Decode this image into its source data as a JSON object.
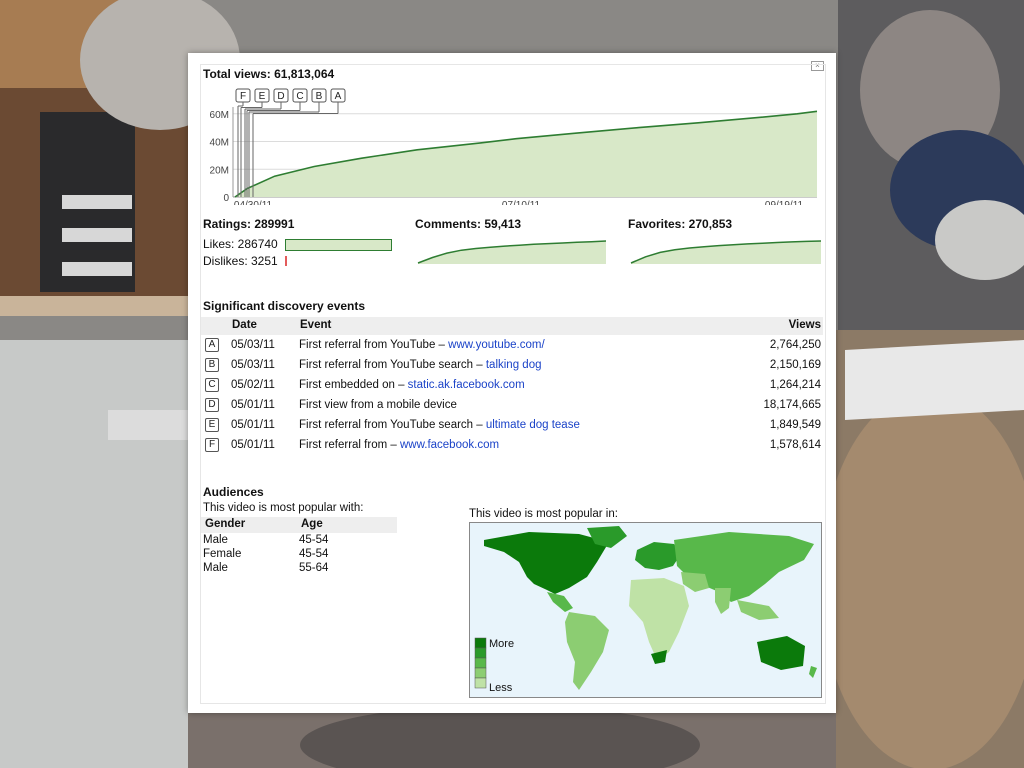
{
  "header": {
    "total_views_label": "Total views: 61,813,064"
  },
  "chart_data": [
    {
      "type": "area",
      "title": "Total views: 61,813,064",
      "x_ticks": [
        "04/30/11",
        "07/10/11",
        "09/19/11"
      ],
      "y_ticks": [
        "0",
        "20M",
        "40M",
        "60M"
      ],
      "ylim": [
        0,
        62000000
      ],
      "x": [
        "04/30/11",
        "05/03/11",
        "05/10/11",
        "05/20/11",
        "06/01/11",
        "06/15/11",
        "07/01/11",
        "07/10/11",
        "07/25/11",
        "08/10/11",
        "08/25/11",
        "09/10/11",
        "09/19/11",
        "09/24/11"
      ],
      "values": [
        0,
        6000000,
        15000000,
        22000000,
        28000000,
        34000000,
        39000000,
        42000000,
        46000000,
        50000000,
        53500000,
        57500000,
        60000000,
        61813064
      ],
      "grid": true,
      "color": "#d8e8c8"
    },
    {
      "type": "area",
      "title": "Comments: 59,413",
      "values": [
        0,
        25,
        45,
        58,
        66,
        72,
        77,
        81,
        85,
        88,
        91,
        94,
        97,
        100
      ]
    },
    {
      "type": "area",
      "title": "Favorites: 270,853",
      "values": [
        0,
        28,
        48,
        60,
        68,
        74,
        79,
        83,
        87,
        90,
        93,
        96,
        98,
        100
      ]
    }
  ],
  "markers": [
    "F",
    "E",
    "D",
    "C",
    "B",
    "A"
  ],
  "ratings": {
    "title": "Ratings: 289991",
    "likes_label": "Likes: 286740",
    "dislikes_label": "Dislikes: 3251",
    "likes_fraction": 0.9888,
    "dislikes_fraction": 0.0112
  },
  "comments": {
    "title": "Comments: 59,413"
  },
  "favorites": {
    "title": "Favorites: 270,853"
  },
  "discovery": {
    "title": "Significant discovery events",
    "headers": {
      "date": "Date",
      "event": "Event",
      "views": "Views"
    },
    "rows": [
      {
        "marker": "A",
        "date": "05/03/11",
        "event": "First referral from YouTube –",
        "link": "www.youtube.com/",
        "views": "2,764,250"
      },
      {
        "marker": "B",
        "date": "05/03/11",
        "event": "First referral from YouTube search –",
        "link": "talking dog",
        "views": "2,150,169"
      },
      {
        "marker": "C",
        "date": "05/02/11",
        "event": "First embedded on –",
        "link": "static.ak.facebook.com",
        "views": "1,264,214"
      },
      {
        "marker": "D",
        "date": "05/01/11",
        "event": "First view from a mobile device",
        "link": "",
        "views": "18,174,665"
      },
      {
        "marker": "E",
        "date": "05/01/11",
        "event": "First referral from YouTube search –",
        "link": "ultimate dog tease",
        "views": "1,849,549"
      },
      {
        "marker": "F",
        "date": "05/01/11",
        "event": "First referral from –",
        "link": "www.facebook.com",
        "views": "1,578,614"
      }
    ]
  },
  "audiences": {
    "title": "Audiences",
    "subtitle": "This video is most popular with:",
    "headers": {
      "gender": "Gender",
      "age": "Age"
    },
    "rows": [
      {
        "gender": "Male",
        "age": "45-54"
      },
      {
        "gender": "Female",
        "age": "45-54"
      },
      {
        "gender": "Male",
        "age": "55-64"
      }
    ]
  },
  "map": {
    "title": "This video is most popular in:",
    "legend_more": "More",
    "legend_less": "Less",
    "colors": [
      "#0b7a0b",
      "#2a9a2a",
      "#58b84a",
      "#8ccd72",
      "#bfe2a6"
    ]
  },
  "colors": {
    "area_fill": "#d8e8c8",
    "line": "#2e7d32",
    "link": "#1b43c8",
    "dislike": "#e35b5b"
  }
}
